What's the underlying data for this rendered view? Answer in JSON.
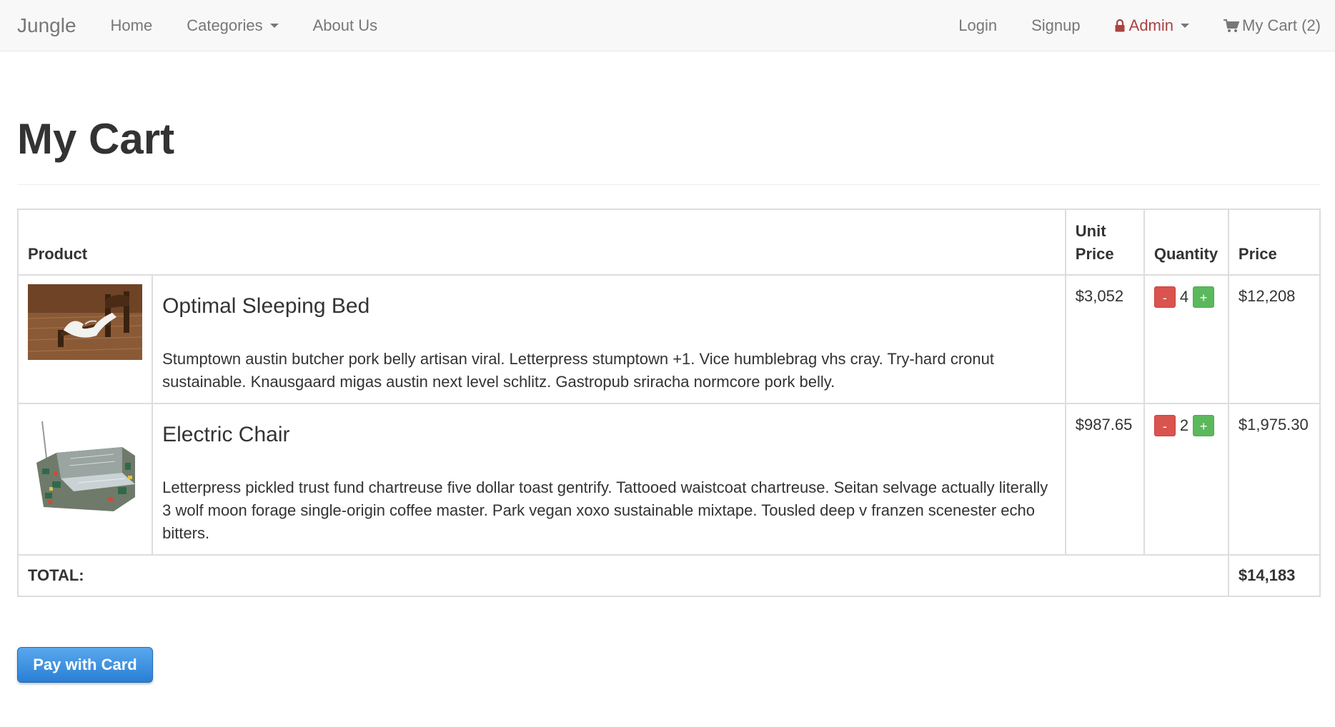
{
  "navbar": {
    "brand": "Jungle",
    "home": "Home",
    "categories": "Categories",
    "about": "About Us",
    "login": "Login",
    "signup": "Signup",
    "admin": "Admin",
    "cart": "My Cart (2)"
  },
  "page": {
    "title": "My Cart"
  },
  "table": {
    "headers": {
      "product": "Product",
      "unit_price": "Unit Price",
      "quantity": "Quantity",
      "price": "Price"
    },
    "rows": [
      {
        "name": "Optimal Sleeping Bed",
        "description": "Stumptown austin butcher pork belly artisan viral. Letterpress stumptown +1. Vice humblebrag vhs cray. Try-hard cronut sustainable. Knausgaard migas austin next level schlitz. Gastropub sriracha normcore pork belly.",
        "unit_price": "$3,052",
        "quantity": "4",
        "price": "$12,208"
      },
      {
        "name": "Electric Chair",
        "description": "Letterpress pickled trust fund chartreuse five dollar toast gentrify. Tattooed waistcoat chartreuse. Seitan selvage actually literally 3 wolf moon forage single-origin coffee master. Park vegan xoxo sustainable mixtape. Tousled deep v franzen scenester echo bitters.",
        "unit_price": "$987.65",
        "quantity": "2",
        "price": "$1,975.30"
      }
    ],
    "minus_label": "-",
    "plus_label": "+",
    "total_label": "TOTAL:",
    "total_value": "$14,183"
  },
  "pay_button": "Pay with Card",
  "colors": {
    "navbar_bg": "#f8f8f8",
    "admin": "#a94442",
    "minus": "#d9534f",
    "plus": "#5cb85c",
    "pay": "#2a7fd4"
  }
}
